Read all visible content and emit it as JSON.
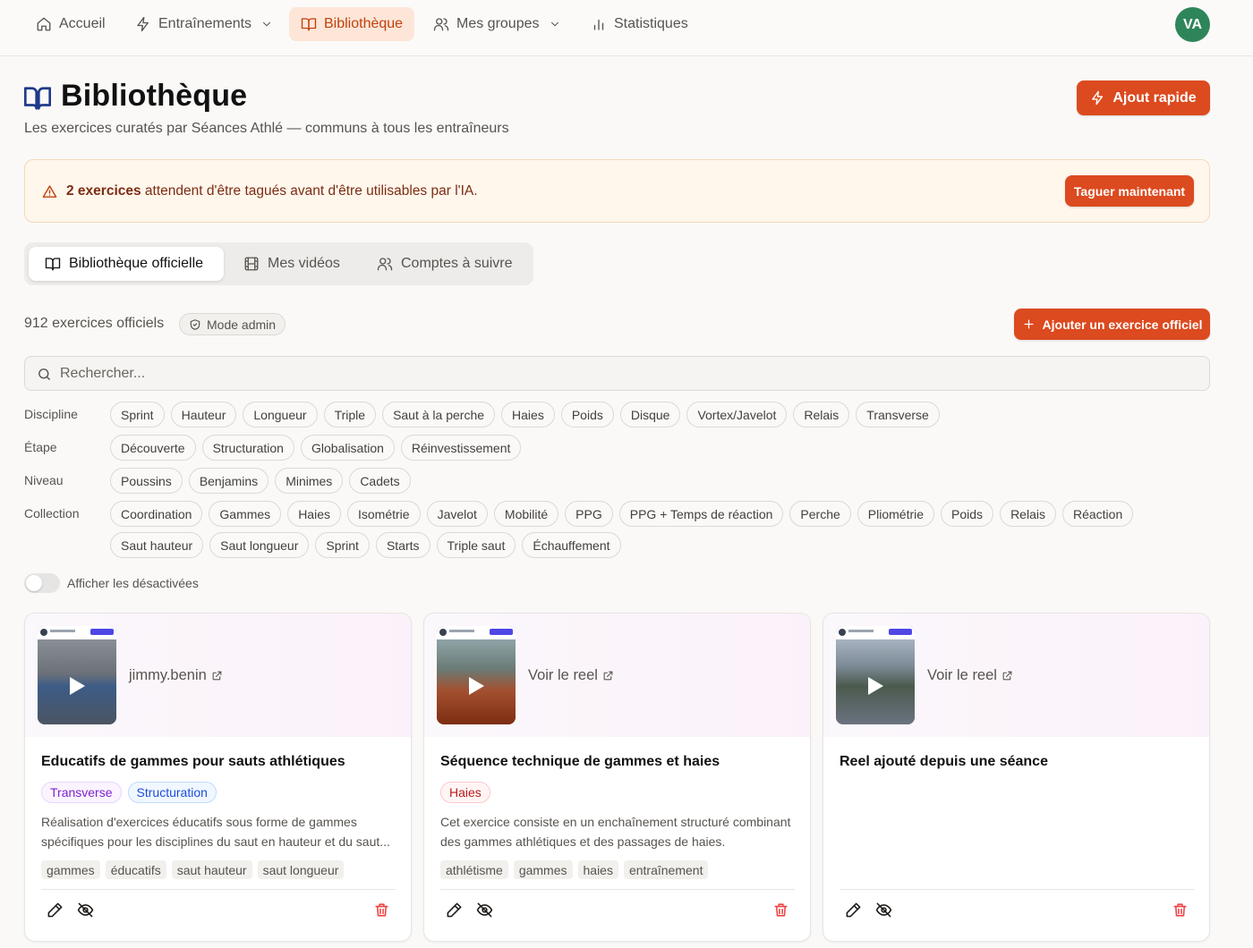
{
  "nav": {
    "items": [
      {
        "label": "Accueil",
        "icon": "home-icon"
      },
      {
        "label": "Entraînements",
        "icon": "bolt-icon",
        "dropdown": true
      },
      {
        "label": "Bibliothèque",
        "icon": "book-icon",
        "active": true
      },
      {
        "label": "Mes groupes",
        "icon": "users-icon",
        "dropdown": true
      },
      {
        "label": "Statistiques",
        "icon": "bar-chart-icon"
      }
    ],
    "avatar": "VA"
  },
  "header": {
    "title": "Bibliothèque",
    "subtitle": "Les exercices curatés par Séances Athlé — communs à tous les entraîneurs",
    "quick_add": "Ajout rapide"
  },
  "alert": {
    "strong": "2 exercices",
    "text": " attendent d'être tagués avant d'être utilisables par l'IA.",
    "button": "Taguer maintenant"
  },
  "tabs": [
    {
      "label": "Bibliothèque officielle",
      "icon": "book-icon",
      "active": true
    },
    {
      "label": "Mes vidéos",
      "icon": "film-icon"
    },
    {
      "label": "Comptes à suivre",
      "icon": "users-icon"
    }
  ],
  "toolbar": {
    "count": "912 exercices officiels",
    "admin_badge": "Mode admin",
    "add_button": "Ajouter un exercice officiel"
  },
  "search": {
    "placeholder": "Rechercher..."
  },
  "filters": {
    "discipline": {
      "label": "Discipline",
      "chips": [
        "Sprint",
        "Hauteur",
        "Longueur",
        "Triple",
        "Saut à la perche",
        "Haies",
        "Poids",
        "Disque",
        "Vortex/Javelot",
        "Relais",
        "Transverse"
      ]
    },
    "etape": {
      "label": "Étape",
      "chips": [
        "Découverte",
        "Structuration",
        "Globalisation",
        "Réinvestissement"
      ]
    },
    "niveau": {
      "label": "Niveau",
      "chips": [
        "Poussins",
        "Benjamins",
        "Minimes",
        "Cadets"
      ]
    },
    "collection": {
      "label": "Collection",
      "chips_row1": [
        "Coordination",
        "Gammes",
        "Haies",
        "Isométrie",
        "Javelot",
        "Mobilité",
        "PPG",
        "PPG + Temps de réaction",
        "Perche",
        "Pliométrie",
        "Poids",
        "Relais",
        "Réaction"
      ],
      "chips_row2": [
        "Saut hauteur",
        "Saut longueur",
        "Sprint",
        "Starts",
        "Triple saut",
        "Échauffement"
      ]
    }
  },
  "toggle": {
    "label": "Afficher les désactivées",
    "on": false
  },
  "cards": [
    {
      "link": "jimmy.benin",
      "title": "Educatifs de gammes pour sauts athlétiques",
      "tags": [
        {
          "label": "Transverse",
          "color": "#7e22ce"
        },
        {
          "label": "Structuration",
          "color": "#1d4ed8"
        }
      ],
      "description": "Réalisation d'exercices éducatifs sous forme de gammes spécifiques pour les disciplines du saut en hauteur et du saut...",
      "keywords": [
        "gammes",
        "éducatifs",
        "saut hauteur",
        "saut longueur"
      ]
    },
    {
      "link": "Voir le reel",
      "title": "Séquence technique de gammes et haies",
      "tags": [
        {
          "label": "Haies",
          "color": "#b91c1c"
        }
      ],
      "description": "Cet exercice consiste en un enchaînement structuré combinant des gammes athlétiques et des passages de haies.",
      "keywords": [
        "athlétisme",
        "gammes",
        "haies",
        "entraînement"
      ]
    },
    {
      "link": "Voir le reel",
      "title": "Reel ajouté depuis une séance",
      "tags": [],
      "description": "",
      "keywords": []
    }
  ],
  "colors": {
    "accent": "#dc4a1f",
    "avatar": "#2f855a",
    "alert_bg": "#fff6ec"
  }
}
